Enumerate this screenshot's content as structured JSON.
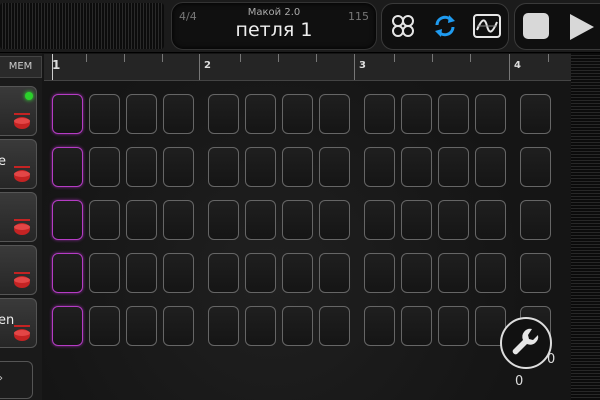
{
  "header": {
    "time_signature": "4/4",
    "subtitle": "Макой 2.0",
    "pattern_name": "петля 1",
    "tempo": "115"
  },
  "modes": [
    {
      "icon": "chain-link-icon",
      "active": false
    },
    {
      "icon": "loop-repeat-icon",
      "active": true
    },
    {
      "icon": "waveform-graph-icon",
      "active": false
    }
  ],
  "transport": {
    "stop_icon": "stop-icon",
    "play_icon": "play-icon"
  },
  "left_panel": {
    "mem_label": "MEM",
    "tracks": [
      {
        "label": "",
        "led": true
      },
      {
        "label": "e",
        "led": false
      },
      {
        "label": "",
        "led": false
      },
      {
        "label": "",
        "led": false
      },
      {
        "label": "en",
        "led": false
      }
    ],
    "footer_label": "›"
  },
  "timeline": {
    "bars": [
      "1",
      "2",
      "3",
      "4"
    ]
  },
  "grid": {
    "rows": 5,
    "steps_visible": 14
  },
  "tools": {
    "wrench_icon": "wrench-icon",
    "value_a": "0",
    "value_b": "0"
  },
  "colors": {
    "accent": "#1f9bf0",
    "step_highlight": "#b53cc4",
    "led": "#2bd12b"
  }
}
